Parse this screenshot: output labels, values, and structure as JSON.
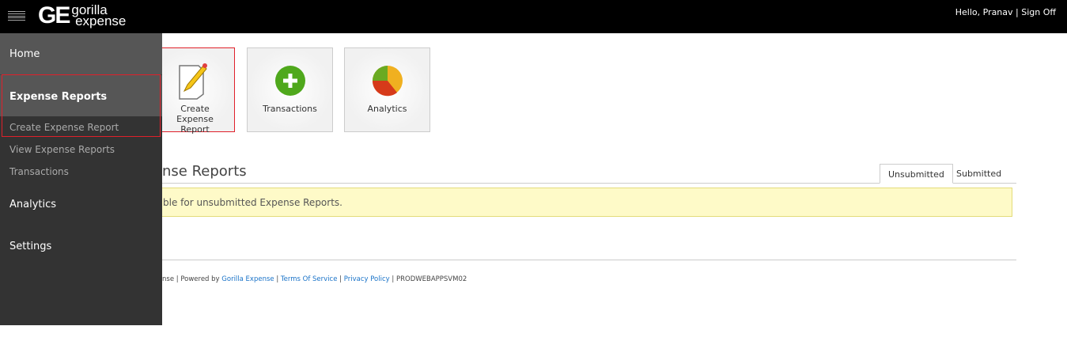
{
  "header": {
    "logo_text": "gorilla expense",
    "logo_mark": "GE",
    "greeting": "Hello, Pranav",
    "separator": "|",
    "sign_off": "Sign Off"
  },
  "sidebar": {
    "home": "Home",
    "expense_reports": "Expense Reports",
    "sub_items": [
      "Create Expense Report",
      "View Expense Reports",
      "Transactions"
    ],
    "analytics": "Analytics",
    "settings": "Settings"
  },
  "tiles": [
    {
      "label": "Create Expense Report",
      "icon": "pencil-paper-icon"
    },
    {
      "label": "Transactions",
      "icon": "green-plus-icon"
    },
    {
      "label": "Analytics",
      "icon": "pie-chart-icon"
    }
  ],
  "section": {
    "title_visible": "nse Reports",
    "tabs": [
      "Unsubmitted",
      "Submitted"
    ],
    "notice_visible": "ble for unsubmitted Expense Reports."
  },
  "footer": {
    "prefix_visible": "nse | Powered by ",
    "powered_link": "Gorilla Expense",
    "sep": " | ",
    "terms": "Terms Of Service",
    "privacy": "Privacy Policy",
    "server": "PRODWEBAPPSVM02"
  },
  "colors": {
    "highlight": "#e0202a",
    "notice_bg": "#fefac8",
    "link": "#1a73c8"
  }
}
